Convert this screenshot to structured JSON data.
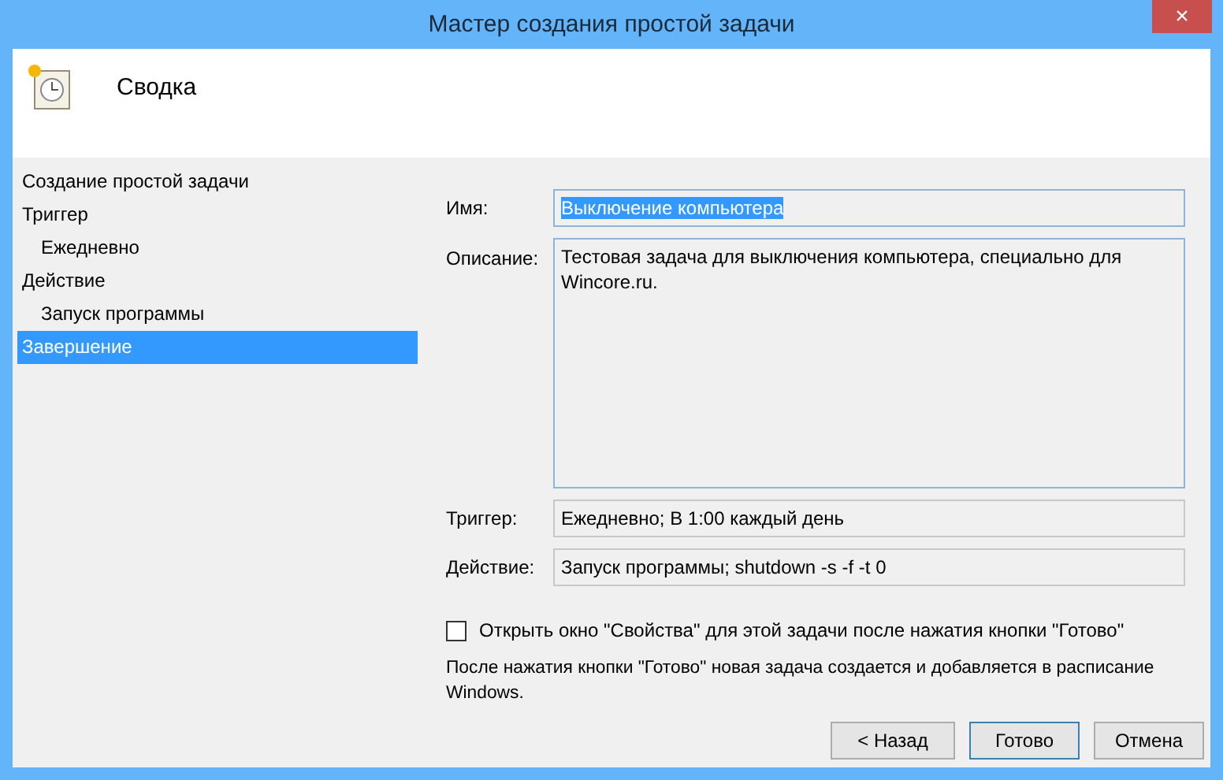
{
  "window": {
    "title": "Мастер создания простой задачи",
    "close": "×"
  },
  "header": {
    "title": "Сводка"
  },
  "sidebar": {
    "items": [
      {
        "label": "Создание простой задачи",
        "selected": false
      },
      {
        "label": "Триггер",
        "selected": false,
        "children": [
          {
            "label": "Ежедневно",
            "selected": false
          }
        ]
      },
      {
        "label": "Действие",
        "selected": false,
        "children": [
          {
            "label": "Запуск программы",
            "selected": false
          }
        ]
      },
      {
        "label": "Завершение",
        "selected": true
      }
    ]
  },
  "form": {
    "name": {
      "label": "Имя:",
      "value": "Выключение компьютера",
      "text_selected": true
    },
    "description": {
      "label": "Описание:",
      "value": "Тестовая задача для выключения компьютера, специально для Wincore.ru."
    },
    "trigger": {
      "label": "Триггер:",
      "value": "Ежедневно; В 1:00 каждый день"
    },
    "action": {
      "label": "Действие:",
      "value": "Запуск программы; shutdown -s -f -t 0"
    }
  },
  "open_properties": {
    "label": "Открыть окно \"Свойства\" для этой задачи после нажатия кнопки \"Готово\"",
    "checked": false
  },
  "note": "После нажатия кнопки \"Готово\" новая задача создается и добавляется в расписание Windows.",
  "buttons": [
    {
      "label": "< Назад",
      "focused": false
    },
    {
      "label": "Готово",
      "focused": true
    },
    {
      "label": "Отмена",
      "focused": false
    }
  ]
}
